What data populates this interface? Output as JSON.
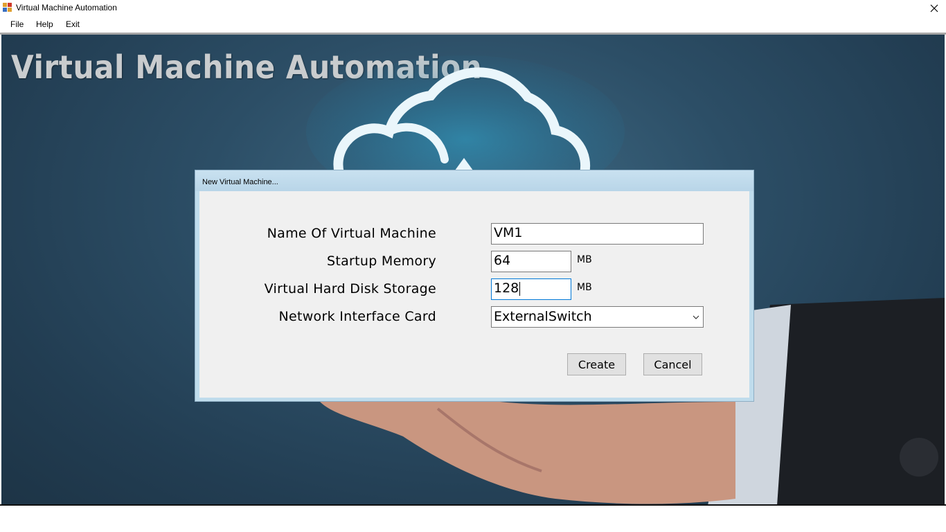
{
  "window": {
    "title": "Virtual Machine Automation",
    "close_glyph": "✕"
  },
  "menu": {
    "items": [
      {
        "label": "File"
      },
      {
        "label": "Help"
      },
      {
        "label": "Exit"
      }
    ]
  },
  "banner": {
    "title": "Virtual Machine Automation"
  },
  "dialog": {
    "title": "New Virtual Machine...",
    "fields": {
      "name": {
        "label": "Name Of Virtual Machine",
        "value": "VM1"
      },
      "memory": {
        "label": "Startup Memory",
        "value": "64",
        "unit": "MB"
      },
      "disk": {
        "label": "Virtual Hard Disk Storage",
        "value": "128",
        "unit": "MB"
      },
      "nic": {
        "label": "Network Interface Card",
        "value": "ExternalSwitch"
      }
    },
    "buttons": {
      "create": "Create",
      "cancel": "Cancel"
    }
  },
  "icons": {
    "app": "app-icon",
    "cloud": "cloud-icon",
    "hand": "hand-image",
    "dropdown": "chevron-down-icon"
  },
  "colors": {
    "background": "#2c4e66",
    "dialog_frame": "#bfdcec",
    "dialog_body": "#f0f0f0",
    "focus_border": "#0078d7",
    "cloud_glow": "#3ab0d8"
  }
}
